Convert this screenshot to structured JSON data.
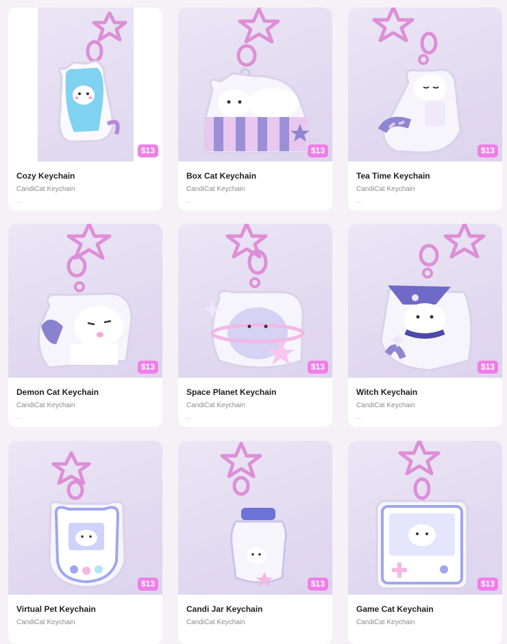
{
  "products": [
    {
      "title": "Cozy Keychain",
      "brand": "CandiCat Keychain",
      "more": "...",
      "price": "$13",
      "image_icon": "cat-hoodie-keychain-icon",
      "accent": "#7fd3f0"
    },
    {
      "title": "Box Cat Keychain",
      "brand": "CandiCat Keychain",
      "more": "...",
      "price": "$13",
      "image_icon": "cat-in-box-keychain-icon",
      "accent": "#9b8fd8"
    },
    {
      "title": "Tea Time Keychain",
      "brand": "CandiCat Keychain",
      "more": "...",
      "price": "$13",
      "image_icon": "cat-tea-keychain-icon",
      "accent": "#8f86d2"
    },
    {
      "title": "Demon Cat Keychain",
      "brand": "CandiCat Keychain",
      "more": "...",
      "price": "$13",
      "image_icon": "demon-cat-keychain-icon",
      "accent": "#8a82cf"
    },
    {
      "title": "Space Planet Keychain",
      "brand": "CandiCat Keychain",
      "more": "...",
      "price": "$13",
      "image_icon": "planet-cat-keychain-icon",
      "accent": "#a9a2e6"
    },
    {
      "title": "Witch Keychain",
      "brand": "CandiCat Keychain",
      "more": "...",
      "price": "$13",
      "image_icon": "witch-cat-keychain-icon",
      "accent": "#6f6ac8"
    },
    {
      "title": "Virtual Pet Keychain",
      "brand": "CandiCat Keychain",
      "more": "...",
      "price": "$13",
      "image_icon": "virtual-pet-keychain-icon",
      "accent": "#9fa6ef"
    },
    {
      "title": "Candi Jar Keychain",
      "brand": "CandiCat Keychain",
      "more": "...",
      "price": "$13",
      "image_icon": "jar-cat-keychain-icon",
      "accent": "#6c73d6"
    },
    {
      "title": "Game Cat Keychain",
      "brand": "CandiCat Keychain",
      "more": "...",
      "price": "$13",
      "image_icon": "game-cat-keychain-icon",
      "accent": "#a0a6ec"
    }
  ],
  "colors": {
    "price_badge": "#f07ee8",
    "page_bg": "#f5f1f7",
    "clasp": "#dd8fd6"
  }
}
